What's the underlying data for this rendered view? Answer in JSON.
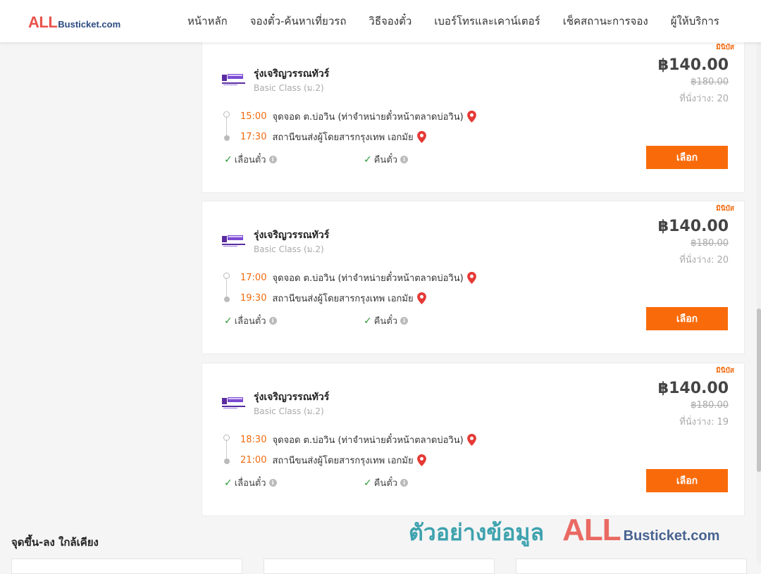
{
  "header": {
    "logo_all": "ALL",
    "logo_rest": "Busticket.com",
    "nav": [
      "หน้าหลัก",
      "จองตั๋ว-ค้นหาเที่ยวรถ",
      "วิธีจองตั๋ว",
      "เบอร์โทรและเคาน์เตอร์",
      "เช็คสถานะการจอง",
      "ผู้ให้บริการ"
    ]
  },
  "colors": {
    "accent": "#f96b0a",
    "time": "#f26b0f",
    "check": "#2e9b3a",
    "pin": "#e53935",
    "logo_red": "#e8524a",
    "logo_blue": "#2a4a7f"
  },
  "trips": [
    {
      "badge": "มินิบัส",
      "operator": "รุ่งเจริญวรรณทัวร์",
      "class": "Basic Class (ม.2)",
      "price": "฿140.00",
      "old_price": "฿180.00",
      "seats": "ที่นั่งว่าง: 20",
      "depart_time": "15:00",
      "depart_place": "จุดจอด ต.บ่อวิน (ท่าจำหน่ายตั๋วหน้าตลาดบ่อวิน)",
      "arrive_time": "17:30",
      "arrive_place": "สถานีขนส่งผู้โดยสารกรุงเทพ เอกมัย",
      "feature1": "เลื่อนตั๋ว",
      "feature2": "คืนตั๋ว",
      "button": "เลือก"
    },
    {
      "badge": "มินิบัส",
      "operator": "รุ่งเจริญวรรณทัวร์",
      "class": "Basic Class (ม.2)",
      "price": "฿140.00",
      "old_price": "฿180.00",
      "seats": "ที่นั่งว่าง: 20",
      "depart_time": "17:00",
      "depart_place": "จุดจอด ต.บ่อวิน (ท่าจำหน่ายตั๋วหน้าตลาดบ่อวิน)",
      "arrive_time": "19:30",
      "arrive_place": "สถานีขนส่งผู้โดยสารกรุงเทพ เอกมัย",
      "feature1": "เลื่อนตั๋ว",
      "feature2": "คืนตั๋ว",
      "button": "เลือก"
    },
    {
      "badge": "มินิบัส",
      "operator": "รุ่งเจริญวรรณทัวร์",
      "class": "Basic Class (ม.2)",
      "price": "฿140.00",
      "old_price": "฿180.00",
      "seats": "ที่นั่งว่าง: 19",
      "depart_time": "18:30",
      "depart_place": "จุดจอด ต.บ่อวิน (ท่าจำหน่ายตั๋วหน้าตลาดบ่อวิน)",
      "arrive_time": "21:00",
      "arrive_place": "สถานีขนส่งผู้โดยสารกรุงเทพ เอกมัย",
      "feature1": "เลื่อนตั๋ว",
      "feature2": "คืนตั๋ว",
      "button": "เลือก"
    }
  ],
  "nearby_title": "จุดขึ้น-ลง ใกล้เคียง",
  "watermark": {
    "text": "ตัวอย่างข้อมูล",
    "all": "ALL",
    "rest": "Busticket.com"
  }
}
